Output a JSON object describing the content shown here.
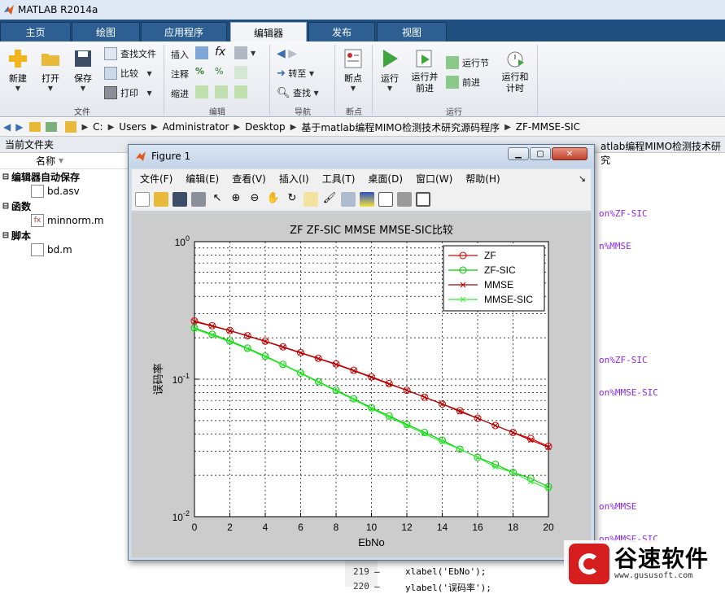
{
  "app": {
    "title": "MATLAB R2014a"
  },
  "tabs": [
    "主页",
    "绘图",
    "应用程序",
    "编辑器",
    "发布",
    "视图"
  ],
  "active_tab": "编辑器",
  "ribbon": {
    "file_group": {
      "label": "文件",
      "new": "新建",
      "open": "打开",
      "save": "保存",
      "find_files": "查找文件",
      "compare": "比较",
      "print": "打印"
    },
    "edit_group": {
      "label": "编辑",
      "insert": "插入",
      "comment": "注释",
      "indent": "缩进"
    },
    "nav_group": {
      "label": "导航",
      "goto": "转至",
      "find": "查找"
    },
    "breakpoint_group": {
      "label": "断点",
      "breakpoint": "断点"
    },
    "run_group": {
      "label": "运行",
      "run": "运行",
      "run_advance": "运行并\n前进",
      "run_section": "运行节",
      "advance": "前进",
      "run_time": "运行和\n计时"
    }
  },
  "address": [
    "C:",
    "Users",
    "Administrator",
    "Desktop",
    "基于matlab编程MIMO检测技术研究源码程序",
    "ZF-MMSE-SIC"
  ],
  "current_folder": {
    "title": "当前文件夹",
    "column": "名称",
    "groups": [
      {
        "name": "编辑器自动保存",
        "files": [
          "bd.asv"
        ]
      },
      {
        "name": "函数",
        "files": [
          "minnorm.m"
        ]
      },
      {
        "name": "脚本",
        "files": [
          "bd.m"
        ]
      }
    ]
  },
  "editor": {
    "tab_fragment": "atlab编程MIMO检测技术研究",
    "fragments": [
      {
        "text": "on%ZF-SIC"
      },
      {
        "text": "n%MMSE"
      },
      {
        "text": "on%ZF-SIC"
      },
      {
        "text": "on%MMSE-SIC"
      },
      {
        "text": "on%MMSE"
      },
      {
        "text": "on%MMSE-SIC"
      }
    ],
    "lines": [
      {
        "num": "219",
        "marker": "–",
        "code": "xlabel('EbNo');"
      },
      {
        "num": "220",
        "marker": "–",
        "code": "ylabel('误码率');"
      }
    ]
  },
  "figure": {
    "title": "Figure 1",
    "menu": [
      "文件(F)",
      "编辑(E)",
      "查看(V)",
      "插入(I)",
      "工具(T)",
      "桌面(D)",
      "窗口(W)",
      "帮助(H)"
    ],
    "menu_arrow": "↘"
  },
  "chart_data": {
    "type": "line",
    "title": "ZF ZF-SIC MMSE MMSE-SIC比较",
    "xlabel": "EbNo",
    "ylabel": "误码率",
    "xlim": [
      0,
      20
    ],
    "ylim": [
      0.01,
      1
    ],
    "yscale": "log",
    "grid": true,
    "legend_position": "top-right",
    "x_ticks": [
      0,
      2,
      4,
      6,
      8,
      10,
      12,
      14,
      16,
      18,
      20
    ],
    "y_ticks": [
      "10^0",
      "10^-1",
      "10^-2"
    ],
    "series": [
      {
        "name": "ZF",
        "color": "#dd0000",
        "marker": "o",
        "x": [
          0,
          1,
          2,
          3,
          4,
          5,
          6,
          7,
          8,
          9,
          10,
          11,
          12,
          13,
          14,
          15,
          16,
          17,
          18,
          19,
          20
        ],
        "y": [
          0.265,
          0.245,
          0.226,
          0.207,
          0.189,
          0.172,
          0.156,
          0.142,
          0.129,
          0.116,
          0.104,
          0.093,
          0.083,
          0.074,
          0.066,
          0.059,
          0.052,
          0.046,
          0.041,
          0.037,
          0.0325
        ]
      },
      {
        "name": "ZF-SIC",
        "color": "#00cc00",
        "marker": "o",
        "x": [
          0,
          1,
          2,
          3,
          4,
          5,
          6,
          7,
          8,
          9,
          10,
          11,
          12,
          13,
          14,
          15,
          16,
          17,
          18,
          19,
          20
        ],
        "y": [
          0.236,
          0.212,
          0.19,
          0.168,
          0.147,
          0.128,
          0.111,
          0.096,
          0.083,
          0.072,
          0.062,
          0.054,
          0.047,
          0.041,
          0.036,
          0.031,
          0.027,
          0.024,
          0.021,
          0.019,
          0.0165
        ]
      },
      {
        "name": "MMSE",
        "color": "#aa0000",
        "marker": "x",
        "x": [
          0,
          1,
          2,
          3,
          4,
          5,
          6,
          7,
          8,
          9,
          10,
          11,
          12,
          13,
          14,
          15,
          16,
          17,
          18,
          19,
          20
        ],
        "y": [
          0.262,
          0.243,
          0.225,
          0.206,
          0.188,
          0.171,
          0.155,
          0.141,
          0.128,
          0.115,
          0.103,
          0.092,
          0.083,
          0.074,
          0.066,
          0.058,
          0.052,
          0.046,
          0.041,
          0.036,
          0.032
        ]
      },
      {
        "name": "MMSE-SIC",
        "color": "#33ee33",
        "marker": "x",
        "x": [
          0,
          1,
          2,
          3,
          4,
          5,
          6,
          7,
          8,
          9,
          10,
          11,
          12,
          13,
          14,
          15,
          16,
          17,
          18,
          19,
          20
        ],
        "y": [
          0.232,
          0.209,
          0.187,
          0.166,
          0.145,
          0.127,
          0.11,
          0.095,
          0.082,
          0.071,
          0.061,
          0.053,
          0.046,
          0.04,
          0.035,
          0.031,
          0.027,
          0.023,
          0.021,
          0.018,
          0.016
        ]
      }
    ]
  },
  "watermark": {
    "brand": "谷速软件",
    "url": "www.gususoft.com"
  },
  "colors": {
    "tab_bar": "#1f4f7f",
    "accent": "#2d5f92"
  }
}
